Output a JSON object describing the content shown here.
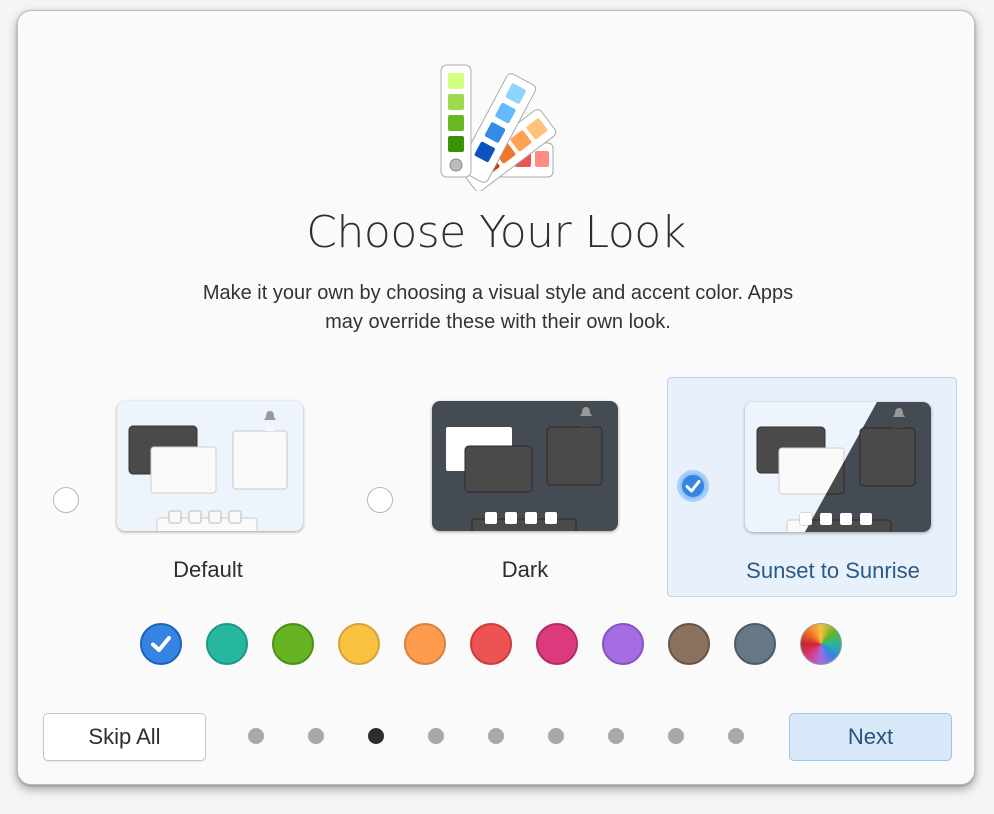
{
  "header": {
    "icon": "color-palette-icon",
    "title": "Choose Your Look",
    "subtitle": "Make it your own by choosing a visual style and accent color. Apps may override these with their own look."
  },
  "styles": [
    {
      "label": "Default",
      "selected": false,
      "icon": "default-style-preview"
    },
    {
      "label": "Dark",
      "selected": false,
      "icon": "dark-style-preview"
    },
    {
      "label": "Sunset to Sunrise",
      "selected": true,
      "icon": "sunset-to-sunrise-style-preview"
    }
  ],
  "accent_colors": [
    {
      "name": "blue",
      "color": "#3584e4",
      "selected": true
    },
    {
      "name": "teal",
      "color": "#26b7a0",
      "selected": false
    },
    {
      "name": "green",
      "color": "#66b421",
      "selected": false
    },
    {
      "name": "yellow",
      "color": "#f8c13f",
      "selected": false
    },
    {
      "name": "orange",
      "color": "#fd9b4e",
      "selected": false
    },
    {
      "name": "red",
      "color": "#ed5353",
      "selected": false
    },
    {
      "name": "pink",
      "color": "#dd3a7e",
      "selected": false
    },
    {
      "name": "purple",
      "color": "#a56de2",
      "selected": false
    },
    {
      "name": "brown",
      "color": "#8a715e",
      "selected": false
    },
    {
      "name": "slate",
      "color": "#667885",
      "selected": false
    },
    {
      "name": "auto",
      "color": "multicolor",
      "selected": false
    }
  ],
  "footer": {
    "skip_label": "Skip All",
    "next_label": "Next",
    "page_count": 9,
    "current_page": 3
  }
}
